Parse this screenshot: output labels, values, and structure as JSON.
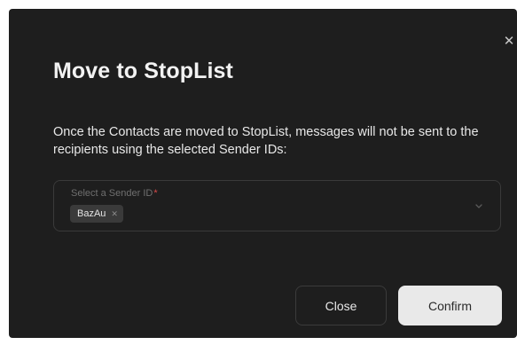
{
  "dialog": {
    "title": "Move to StopList",
    "close_icon": "close-icon",
    "description": "Once the Contacts are moved to StopList, messages will not be sent to the recipients using the selected Sender IDs:"
  },
  "sender_select": {
    "label": "Select a Sender ID",
    "required_mark": "*",
    "selected_chips": [
      {
        "label": "BazAu",
        "remove_icon": "close-icon"
      }
    ],
    "dropdown_icon": "chevron-down-icon"
  },
  "actions": {
    "close_label": "Close",
    "confirm_label": "Confirm"
  },
  "colors": {
    "dialog_background": "#1e1e1e",
    "required": "#d94a4a",
    "confirm_background": "#e9e9e9"
  }
}
